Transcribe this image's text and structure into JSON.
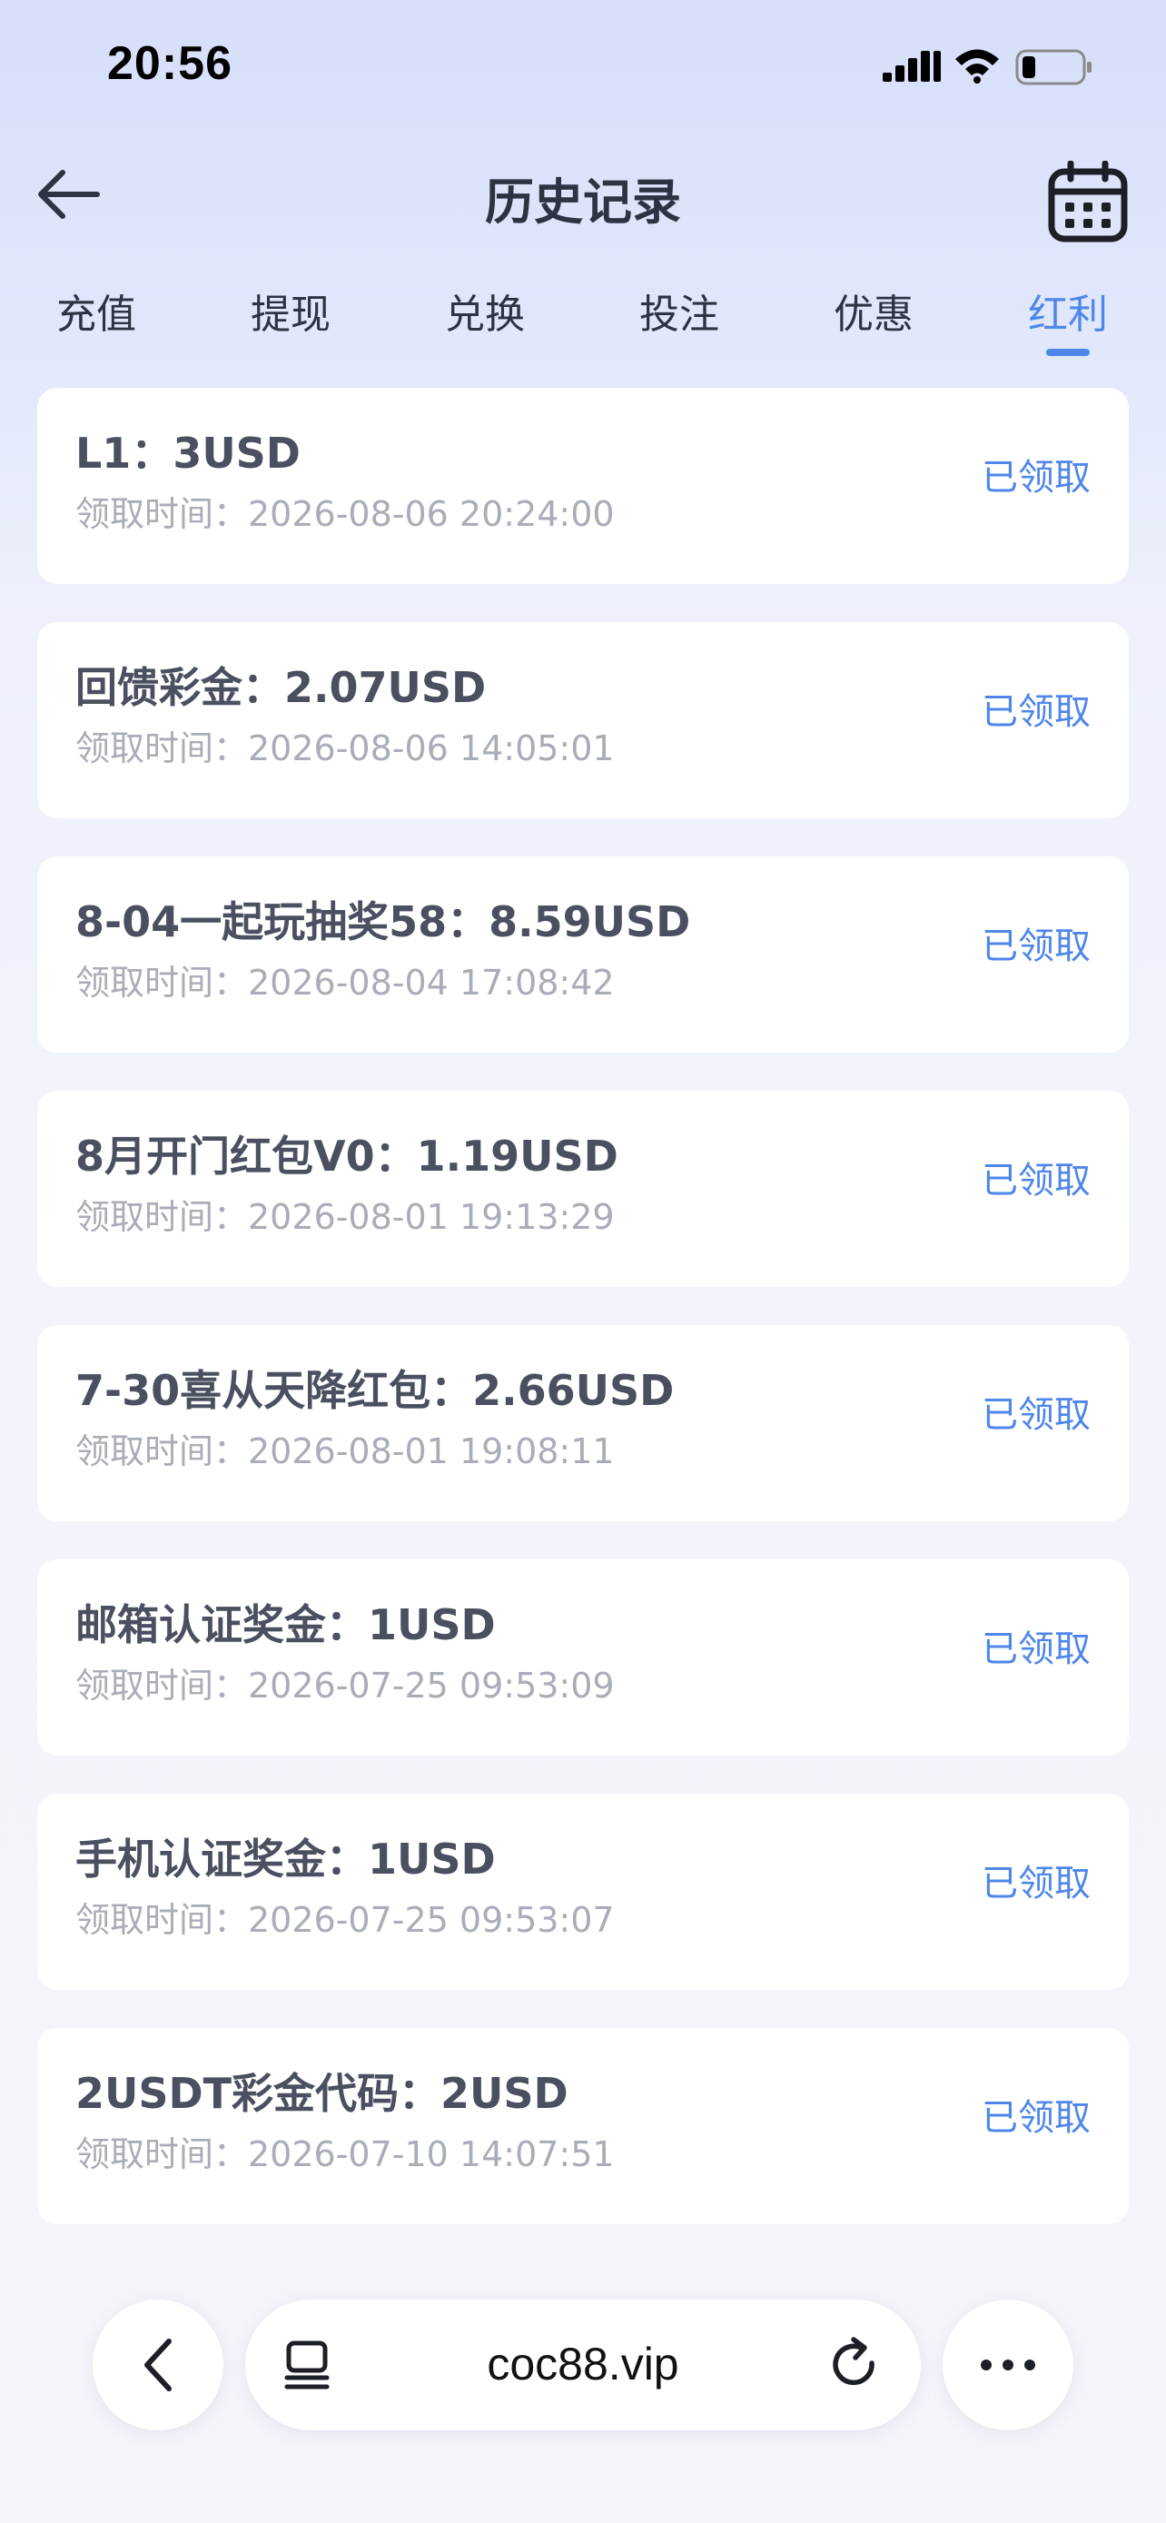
{
  "status_bar": {
    "time": "20:56",
    "signal_icon": "cellular-signal-icon",
    "wifi_icon": "wifi-icon",
    "battery_icon": "battery-low-icon"
  },
  "header": {
    "title": "历史记录",
    "back_icon": "arrow-left-icon",
    "calendar_icon": "calendar-icon"
  },
  "tabs": [
    {
      "label": "充值",
      "active": false
    },
    {
      "label": "提现",
      "active": false
    },
    {
      "label": "兑换",
      "active": false
    },
    {
      "label": "投注",
      "active": false
    },
    {
      "label": "优惠",
      "active": false
    },
    {
      "label": "红利",
      "active": true
    }
  ],
  "records": [
    {
      "title": "L1：3USD",
      "time": "领取时间：2026-08-06 20:24:00",
      "status": "已领取"
    },
    {
      "title": "回馈彩金：2.07USD",
      "time": "领取时间：2026-08-06 14:05:01",
      "status": "已领取"
    },
    {
      "title": "8-04一起玩抽奖58：8.59USD",
      "time": "领取时间：2026-08-04 17:08:42",
      "status": "已领取"
    },
    {
      "title": "8月开门红包V0：1.19USD",
      "time": "领取时间：2026-08-01 19:13:29",
      "status": "已领取"
    },
    {
      "title": "7-30喜从天降红包：2.66USD",
      "time": "领取时间：2026-08-01 19:08:11",
      "status": "已领取"
    },
    {
      "title": "邮箱认证奖金：1USD",
      "time": "领取时间：2026-07-25 09:53:09",
      "status": "已领取"
    },
    {
      "title": "手机认证奖金：1USD",
      "time": "领取时间：2026-07-25 09:53:07",
      "status": "已领取"
    },
    {
      "title": "2USDT彩金代码：2USD",
      "time": "领取时间：2026-07-10 14:07:51",
      "status": "已领取"
    }
  ],
  "browser": {
    "url": "coc88.vip",
    "back_icon": "chevron-left-icon",
    "tabs_icon": "tabs-overview-icon",
    "reload_icon": "reload-icon",
    "more_icon": "more-dots-icon"
  },
  "colors": {
    "accent": "#4f86ea",
    "title_text": "#2d3340",
    "card_title": "#4a5060",
    "muted_text": "#a9adb7",
    "card_bg": "#ffffff",
    "page_bg_top": "#d6def9"
  }
}
